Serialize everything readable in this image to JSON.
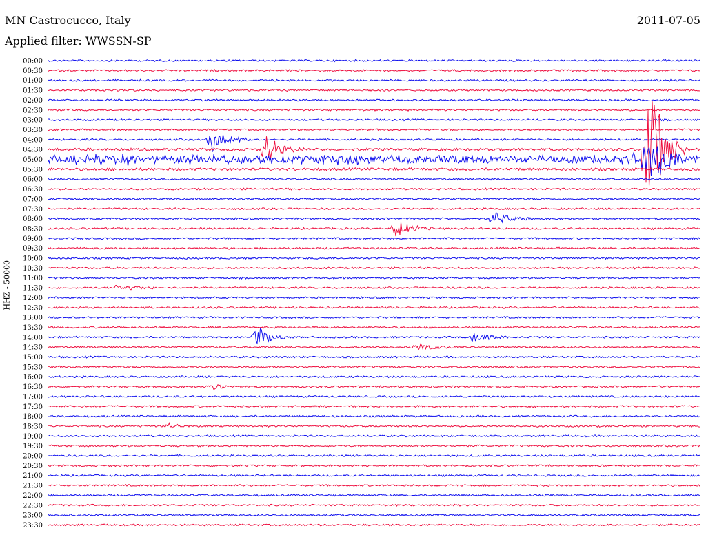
{
  "header": {
    "station": "MN Castrocucco, Italy",
    "filter": "Applied filter: WWSSN-SP",
    "date": "2011-07-05"
  },
  "colors": {
    "blue": "#1010ee",
    "red": "#ee1040"
  },
  "chart_data": {
    "type": "line",
    "title": "MN Castrocucco, Italy",
    "subtitle": "Applied filter: WWSSN-SP",
    "ylabel": "HHZ - 50000",
    "rows": [
      "00:00",
      "00:30",
      "01:00",
      "01:30",
      "02:00",
      "02:30",
      "03:00",
      "03:30",
      "04:00",
      "04:30",
      "05:00",
      "05:30",
      "06:00",
      "06:30",
      "07:00",
      "07:30",
      "08:00",
      "08:30",
      "09:00",
      "09:30",
      "10:00",
      "10:30",
      "11:00",
      "11:30",
      "12:00",
      "12:30",
      "13:00",
      "13:30",
      "14:00",
      "14:30",
      "15:00",
      "15:30",
      "16:00",
      "16:30",
      "17:00",
      "17:30",
      "18:00",
      "18:30",
      "19:00",
      "19:30",
      "20:00",
      "20:30",
      "21:00",
      "21:30",
      "22:00",
      "22:30",
      "23:00",
      "23:30"
    ],
    "row_colors": "alternating blue (even rows) / red (odd rows)",
    "events": [
      {
        "row": "04:00",
        "minute": 7.5,
        "amplitude": 2.2
      },
      {
        "row": "04:30",
        "minute": 10.0,
        "amplitude": 2.0
      },
      {
        "row": "04:30",
        "minute": 27.5,
        "amplitude": 9.5
      },
      {
        "row": "04:30",
        "minute": 27.7,
        "amplitude": 1.8
      },
      {
        "row": "05:00",
        "minute": 27.5,
        "amplitude": 4.0
      },
      {
        "row": "08:00",
        "minute": 20.5,
        "amplitude": 1.0
      },
      {
        "row": "08:30",
        "minute": 16.0,
        "amplitude": 1.3
      },
      {
        "row": "11:30",
        "minute": 3.2,
        "amplitude": 0.5
      },
      {
        "row": "14:00",
        "minute": 9.5,
        "amplitude": 1.5
      },
      {
        "row": "14:00",
        "minute": 19.5,
        "amplitude": 0.7
      },
      {
        "row": "14:30",
        "minute": 17.0,
        "amplitude": 0.5
      },
      {
        "row": "16:30",
        "minute": 7.5,
        "amplitude": 0.3
      },
      {
        "row": "18:30",
        "minute": 5.5,
        "amplitude": 0.3
      }
    ]
  }
}
